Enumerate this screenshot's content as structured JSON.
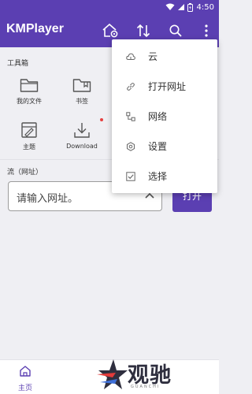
{
  "status_bar": {
    "time": "4:50"
  },
  "app_bar": {
    "title": "KMPlayer",
    "icons": [
      "home-settings-icon",
      "sort-icon",
      "search-icon",
      "more-vert-icon"
    ]
  },
  "toolbox": {
    "title": "工具箱",
    "items": [
      {
        "label": "我的文件",
        "icon": "folder-icon"
      },
      {
        "label": "书签",
        "icon": "bookmark-folder-icon"
      },
      {
        "label": "主题",
        "icon": "theme-icon"
      },
      {
        "label": "Download",
        "icon": "download-icon"
      }
    ]
  },
  "stream": {
    "title": "流（网址）",
    "input_placeholder": "请输入网址。",
    "open_label": "打开"
  },
  "menu": {
    "items": [
      {
        "label": "云",
        "icon": "cloud-icon"
      },
      {
        "label": "打开网址",
        "icon": "link-icon"
      },
      {
        "label": "网络",
        "icon": "network-icon"
      },
      {
        "label": "设置",
        "icon": "settings-icon"
      },
      {
        "label": "选择",
        "icon": "checkbox-icon"
      }
    ]
  },
  "bottom_nav": {
    "home_label": "主页"
  },
  "watermark": {
    "text_cn": "观驰",
    "text_en": "GUANCHI"
  },
  "colors": {
    "primary": "#5b3fb2",
    "background": "#efeff3",
    "notification_dot": "#e64040"
  }
}
